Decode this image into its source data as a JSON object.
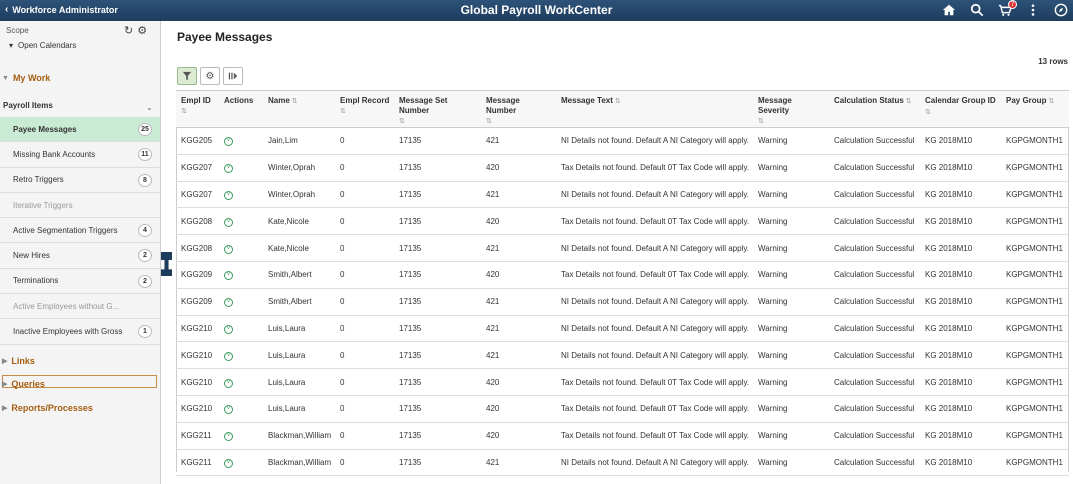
{
  "banner": {
    "back_label": "Workforce Administrator",
    "title": "Global Payroll WorkCenter",
    "notification_count": "7",
    "icons": [
      "home-icon",
      "search-icon",
      "notification-icon",
      "more-icon",
      "navbar-icon"
    ]
  },
  "left": {
    "scope_label": "Scope",
    "open_calendars": "Open Calendars",
    "my_work": "My Work",
    "payroll_items_label": "Payroll Items",
    "items": [
      {
        "label": "Payee Messages",
        "count": "25",
        "active": true,
        "disabled": false
      },
      {
        "label": "Missing Bank Accounts",
        "count": "11",
        "active": false,
        "disabled": false
      },
      {
        "label": "Retro Triggers",
        "count": "8",
        "active": false,
        "disabled": false
      },
      {
        "label": "Iterative Triggers",
        "count": "",
        "active": false,
        "disabled": true
      },
      {
        "label": "Active Segmentation Triggers",
        "count": "4",
        "active": false,
        "disabled": false
      },
      {
        "label": "New Hires",
        "count": "2",
        "active": false,
        "disabled": false
      },
      {
        "label": "Terminations",
        "count": "2",
        "active": false,
        "disabled": false
      },
      {
        "label": "Active Employees without G...",
        "count": "",
        "active": false,
        "disabled": true
      },
      {
        "label": "Inactive Employees with Gross",
        "count": "1",
        "active": false,
        "disabled": false
      }
    ],
    "links": "Links",
    "queries": "Queries",
    "reports": "Reports/Processes"
  },
  "main": {
    "page_title": "Payee Messages",
    "row_count": "13 rows",
    "columns": [
      {
        "l1": "Empl ID",
        "l2": ""
      },
      {
        "l1": "Actions",
        "l2": ""
      },
      {
        "l1": "Name",
        "l2": ""
      },
      {
        "l1": "Empl Record",
        "l2": ""
      },
      {
        "l1": "Message Set",
        "l2": "Number"
      },
      {
        "l1": "Message",
        "l2": "Number"
      },
      {
        "l1": "Message Text",
        "l2": ""
      },
      {
        "l1": "Message",
        "l2": "Severity"
      },
      {
        "l1": "Calculation Status",
        "l2": ""
      },
      {
        "l1": "Calendar Group ID",
        "l2": ""
      },
      {
        "l1": "Pay Group",
        "l2": ""
      }
    ],
    "rows": [
      [
        "KGG205",
        "Jain,Lim",
        "0",
        "17135",
        "421",
        "NI Details not found. Default A NI Category will apply.",
        "Warning",
        "Calculation Successful",
        "KG 2018M10",
        "KGPGMONTH1"
      ],
      [
        "KGG207",
        "Winter,Oprah",
        "0",
        "17135",
        "420",
        "Tax Details not found. Default 0T Tax Code will apply.",
        "Warning",
        "Calculation Successful",
        "KG 2018M10",
        "KGPGMONTH1"
      ],
      [
        "KGG207",
        "Winter,Oprah",
        "0",
        "17135",
        "421",
        "NI Details not found. Default A NI Category will apply.",
        "Warning",
        "Calculation Successful",
        "KG 2018M10",
        "KGPGMONTH1"
      ],
      [
        "KGG208",
        "Kate,Nicole",
        "0",
        "17135",
        "420",
        "Tax Details not found. Default 0T Tax Code will apply.",
        "Warning",
        "Calculation Successful",
        "KG 2018M10",
        "KGPGMONTH1"
      ],
      [
        "KGG208",
        "Kate,Nicole",
        "0",
        "17135",
        "421",
        "NI Details not found. Default A NI Category will apply.",
        "Warning",
        "Calculation Successful",
        "KG 2018M10",
        "KGPGMONTH1"
      ],
      [
        "KGG209",
        "Smith,Albert",
        "0",
        "17135",
        "420",
        "Tax Details not found. Default 0T Tax Code will apply.",
        "Warning",
        "Calculation Successful",
        "KG 2018M10",
        "KGPGMONTH1"
      ],
      [
        "KGG209",
        "Smith,Albert",
        "0",
        "17135",
        "421",
        "NI Details not found. Default A NI Category will apply.",
        "Warning",
        "Calculation Successful",
        "KG 2018M10",
        "KGPGMONTH1"
      ],
      [
        "KGG210",
        "Luis,Laura",
        "0",
        "17135",
        "421",
        "NI Details not found. Default A NI Category will apply.",
        "Warning",
        "Calculation Successful",
        "KG 2018M10",
        "KGPGMONTH1"
      ],
      [
        "KGG210",
        "Luis,Laura",
        "0",
        "17135",
        "421",
        "NI Details not found. Default A NI Category will apply.",
        "Warning",
        "Calculation Successful",
        "KG 2018M10",
        "KGPGMONTH1"
      ],
      [
        "KGG210",
        "Luis,Laura",
        "0",
        "17135",
        "420",
        "Tax Details not found. Default 0T Tax Code will apply.",
        "Warning",
        "Calculation Successful",
        "KG 2018M10",
        "KGPGMONTH1"
      ],
      [
        "KGG210",
        "Luis,Laura",
        "0",
        "17135",
        "420",
        "Tax Details not found. Default 0T Tax Code will apply.",
        "Warning",
        "Calculation Successful",
        "KG 2018M10",
        "KGPGMONTH1"
      ],
      [
        "KGG211",
        "Blackman,William",
        "0",
        "17135",
        "420",
        "Tax Details not found. Default 0T Tax Code will apply.",
        "Warning",
        "Calculation Successful",
        "KG 2018M10",
        "KGPGMONTH1"
      ],
      [
        "KGG211",
        "Blackman,William",
        "0",
        "17135",
        "421",
        "NI Details not found. Default A NI Category will apply.",
        "Warning",
        "Calculation Successful",
        "KG 2018M10",
        "KGPGMONTH1"
      ]
    ]
  }
}
